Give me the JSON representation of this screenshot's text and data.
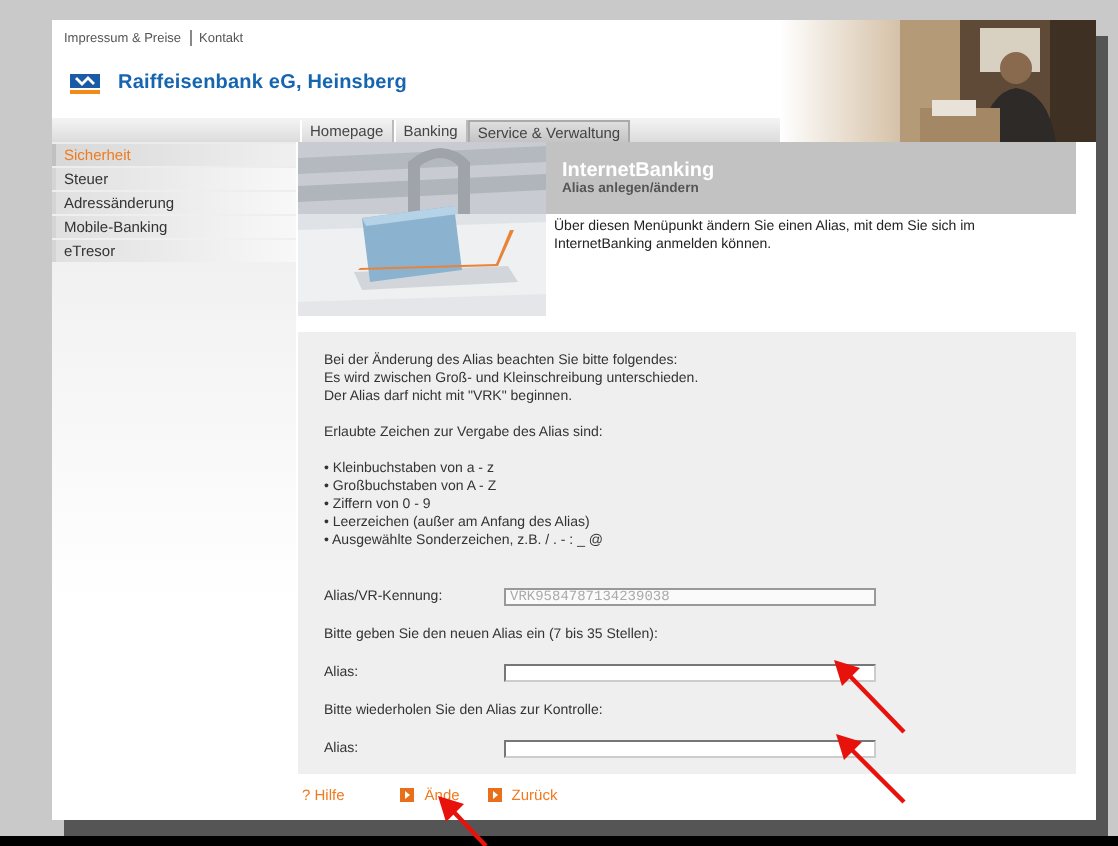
{
  "top_links": [
    {
      "label": "Impressum & Preise"
    },
    {
      "label": "Kontakt"
    }
  ],
  "bank_name": "Raiffeisenbank eG, Heinsberg",
  "tabs": [
    {
      "label": "Homepage",
      "selected": false
    },
    {
      "label": "Banking",
      "selected": false
    },
    {
      "label": "Service & Verwaltung",
      "selected": true
    }
  ],
  "sidebar": {
    "items": [
      {
        "label": "Sicherheit",
        "selected": true
      },
      {
        "label": "Steuer",
        "selected": false
      },
      {
        "label": "Adressänderung",
        "selected": false
      },
      {
        "label": "Mobile-Banking",
        "selected": false
      },
      {
        "label": "eTresor",
        "selected": false
      }
    ]
  },
  "header": {
    "title": "InternetBanking",
    "subtitle": "Alias anlegen/ändern",
    "description": "Über diesen Menüpunkt ändern Sie einen Alias, mit dem Sie sich im InternetBanking anmelden können."
  },
  "form": {
    "intro": [
      "Bei der Änderung des Alias beachten Sie bitte folgendes:",
      "Es wird zwischen Groß- und Kleinschreibung unterschieden.",
      "Der Alias darf nicht mit \"VRK\" beginnen."
    ],
    "allowed_heading": "Erlaubte Zeichen zur Vergabe des Alias sind:",
    "allowed": [
      "• Kleinbuchstaben von a - z",
      "• Großbuchstaben von A - Z",
      "• Ziffern von 0 - 9",
      "• Leerzeichen (außer am Anfang des Alias)",
      "• Ausgewählte Sonderzeichen, z.B. / . - : _ @"
    ],
    "rows": [
      {
        "kind": "field",
        "label": "Alias/VR-Kennung:",
        "value": "VRK9584787134239038",
        "disabled": true
      },
      {
        "kind": "instruction",
        "text": "Bitte geben Sie den neuen Alias ein (7 bis 35 Stellen):"
      },
      {
        "kind": "field",
        "label": "Alias:",
        "disabled": false
      },
      {
        "kind": "instruction",
        "text": "Bitte wiederholen Sie den Alias zur Kontrolle:"
      },
      {
        "kind": "field",
        "label": "Alias:",
        "disabled": false
      }
    ]
  },
  "footer_links": [
    {
      "kind": "help",
      "icon": "?",
      "label": "Hilfe"
    },
    {
      "kind": "action",
      "label": "Ände"
    },
    {
      "kind": "action",
      "label": "Zurück"
    }
  ]
}
